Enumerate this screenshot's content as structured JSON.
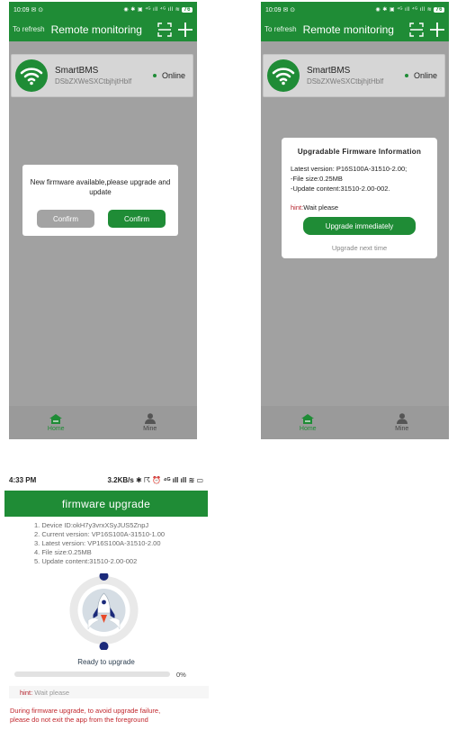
{
  "screens": [
    {
      "status_time": "10:09",
      "status_extra": "✉ ⊙",
      "status_icons": "◉ ✱ ▣ ⁴ᴳ ıll ⁴ᴳ ıll ≋",
      "battery": "76",
      "header": {
        "refresh_label": "To refresh",
        "title": "Remote monitoring"
      },
      "device": {
        "name": "SmartBMS",
        "id": "DSbZXWeSXCtbjhjtHblf",
        "status": "Online"
      },
      "dialog": {
        "message": "New firmware available,please upgrade and update",
        "cancel_label": "Confirm",
        "confirm_label": "Confirm"
      },
      "nav": {
        "home_label": "Home",
        "mine_label": "Mine"
      }
    },
    {
      "status_time": "10:09",
      "status_extra": "✉ ⊙",
      "status_icons": "◉ ✱ ▣ ⁴ᴳ ıll ⁴ᴳ ıll ≋",
      "battery": "76",
      "header": {
        "refresh_label": "To refresh",
        "title": "Remote monitoring"
      },
      "device": {
        "name": "SmartBMS",
        "id": "DSbZXWeSXCtbjhjtHblf",
        "status": "Online"
      },
      "dialog": {
        "title": "Upgradable Firmware Information",
        "latest_version": "Latest version: P16S100A-31510-2.00;",
        "file_size": "-File size:0.25MB",
        "update_content": "-Update content:31510-2.00-002.",
        "hint_label": "hint:",
        "hint_text": "Wait please",
        "upgrade_label": "Upgrade immediately",
        "later_label": "Upgrade next time"
      },
      "nav": {
        "home_label": "Home",
        "mine_label": "Mine"
      }
    }
  ],
  "upgrade_page": {
    "status_time": "4:33 PM",
    "status_icons": "3.2KB/s ✱ ☈ ⏰ ⁴ᴳ ıll ıll ≋ ▭",
    "title": "firmware upgrade",
    "info": [
      "1. Device ID:okH7y3vrxXSyJUS5ZnpJ",
      "2. Current version: VP16S100A-31510-1.00",
      "3. Latest version: VP16S100A-31510-2.00",
      "4. File size:0.25MB",
      "5. Update content:31510-2.00-002"
    ],
    "ready_label": "Ready to upgrade",
    "progress": 0,
    "progress_label": "0%",
    "hint_label": "hint:",
    "hint_text": "Wait please",
    "warning_line1": "During firmware upgrade, to avoid upgrade failure,",
    "warning_line2": "please do not exit the app from the foreground"
  },
  "colors": {
    "brand_green": "#1f8c36",
    "hint_red": "#b3202a",
    "warning_red": "#c1272d",
    "rocket_navy": "#1b2a7a"
  },
  "icons": [
    "scan-icon",
    "add-icon",
    "wifi-icon",
    "home-icon",
    "person-icon",
    "rocket-icon"
  ]
}
